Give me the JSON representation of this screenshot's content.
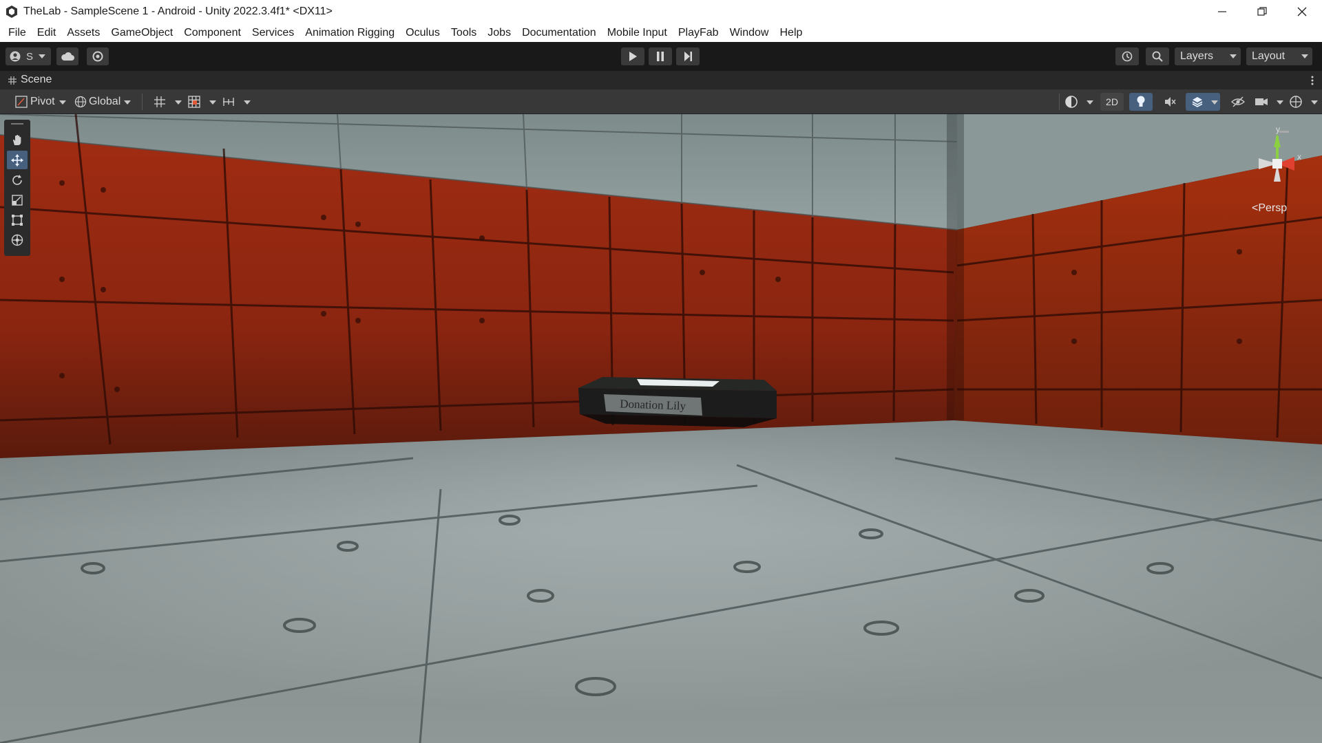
{
  "window": {
    "title": "TheLab - SampleScene 1 - Android - Unity 2022.3.4f1* <DX11>",
    "controls": [
      "minimize-icon",
      "restore-icon",
      "close-icon"
    ]
  },
  "menu": [
    "File",
    "Edit",
    "Assets",
    "GameObject",
    "Component",
    "Services",
    "Animation Rigging",
    "Oculus",
    "Tools",
    "Jobs",
    "Documentation",
    "Mobile Input",
    "PlayFab",
    "Window",
    "Help"
  ],
  "toolbar": {
    "account_label": "S",
    "layers_label": "Layers",
    "layout_label": "Layout"
  },
  "scene": {
    "tab_label": "Scene",
    "pivot_label": "Pivot",
    "global_label": "Global",
    "mode_2d_label": "2D",
    "persp_label": "Persp",
    "object_label": "Donation Lily",
    "gizmo_axes": {
      "x": "x",
      "y": "y"
    }
  },
  "colors": {
    "wall_red": "#9a2a12",
    "concrete": "#8a9696",
    "floor": "#a8b2b2",
    "accent_blue": "#3b84d6",
    "gizmo_x": "#e04030",
    "gizmo_y": "#8ad040"
  }
}
